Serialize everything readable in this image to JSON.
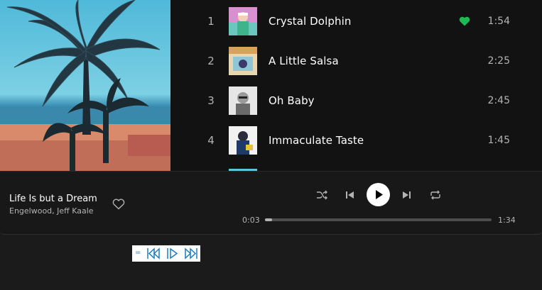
{
  "tracks": [
    {
      "number": "1",
      "title": "Crystal Dolphin",
      "duration": "1:54",
      "liked": true
    },
    {
      "number": "2",
      "title": "A Little Salsa",
      "duration": "2:25",
      "liked": false
    },
    {
      "number": "3",
      "title": "Oh Baby",
      "duration": "2:45",
      "liked": false
    },
    {
      "number": "4",
      "title": "Immaculate Taste",
      "duration": "1:45",
      "liked": false
    }
  ],
  "now_playing": {
    "title": "Life Is but a Dream",
    "artist": "Engelwood, Jeff Kaale",
    "current_time": "0:03",
    "total_time": "1:34",
    "progress_fraction": 0.03
  },
  "controls": {
    "shuffle_icon": "shuffle-icon",
    "previous_icon": "skip-previous-icon",
    "play_icon": "play-icon",
    "next_icon": "skip-next-icon",
    "repeat_icon": "repeat-icon"
  },
  "mini_widget": {
    "eq_label": "=",
    "buttons": [
      "rewind-icon",
      "play-pause-icon",
      "fast-forward-icon"
    ]
  },
  "colors": {
    "accent_green": "#1db954",
    "background": "#121212",
    "player_bg": "#181818",
    "widget_blue": "#1a7dc4"
  }
}
